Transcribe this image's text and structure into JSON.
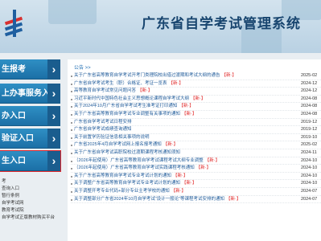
{
  "header": {
    "title": "广东省自学考试管理系统",
    "logo_icon": "gdeea-logo-icon"
  },
  "nav": {
    "items": [
      {
        "label": "生报考",
        "highlight": false
      },
      {
        "label": "上办事服务入口",
        "highlight": false
      },
      {
        "label": "办入口",
        "highlight": false
      },
      {
        "label": "验证入口",
        "highlight": false
      },
      {
        "label": "生入口",
        "highlight": true
      }
    ],
    "links": [
      "考",
      "查询入口",
      "暂行条例",
      "自学考试网",
      "教育考试院",
      "自学考试正版教材购买平台"
    ]
  },
  "main": {
    "breadcrumb": "公告 >>",
    "new_tag": "【新·】",
    "news": [
      {
        "title": "关于广东省高等教育自学考试开考门类理院校出借过渡期和考试大纲的通告",
        "new": true,
        "date": "2025-02"
      },
      {
        "title": "广东省自学考试考生（职）合格证、考证一览表",
        "new": true,
        "date": "2024-12"
      },
      {
        "title": "高等教育自学考试常见问题问答",
        "new": true,
        "date": "2024-12"
      },
      {
        "title": "习近平新时代中国特色社会主义思想概论课程自学考试大纲",
        "new": true,
        "date": "2024-08"
      },
      {
        "title": "关于2024年10月广东省自学考试考生准考证打印通知",
        "new": true,
        "date": "2024-08"
      },
      {
        "title": "关于广东省高等教育自学考试专业调整有关事项的通知",
        "new": true,
        "date": "2024-08"
      },
      {
        "title": "广东省自学考试考试日程安排",
        "new": false,
        "date": "2019-12"
      },
      {
        "title": "广东省自学考试成绩查询通知",
        "new": false,
        "date": "2019-12"
      },
      {
        "title": "关于前置学历验证信息相关事项的说明",
        "new": false,
        "date": "2019-10"
      },
      {
        "title": "广东省2025年4月自学考试网上报名报考通知",
        "new": true,
        "date": "2025-02"
      },
      {
        "title": "关于广东省自学考试高职院校过渡期课程考核通知须知",
        "new": false,
        "date": "2024-11"
      },
      {
        "title": "（2026年起使用）广东省高等教育自学考试课程考试大纲专业调整",
        "new": true,
        "date": "2024-10"
      },
      {
        "title": "（2026年起使用）广东省高等教育自学考试实践课程考核通知",
        "new": true,
        "date": "2024-10"
      },
      {
        "title": "关于广东省高等教育自学考试专业考试计划的通知",
        "new": true,
        "date": "2024-10"
      },
      {
        "title": "关于调整广东省高等教育自学考试专业考试计划的通知",
        "new": true,
        "date": "2024-10"
      },
      {
        "title": "关于调整开考专业代码+部分专业主考学校的通知",
        "new": true,
        "date": "2024-07"
      },
      {
        "title": "关于调整部分广东省2024年10月自学考试“设计一般论”等课程考试安排的通知",
        "new": true,
        "date": "2024-07"
      }
    ]
  }
}
